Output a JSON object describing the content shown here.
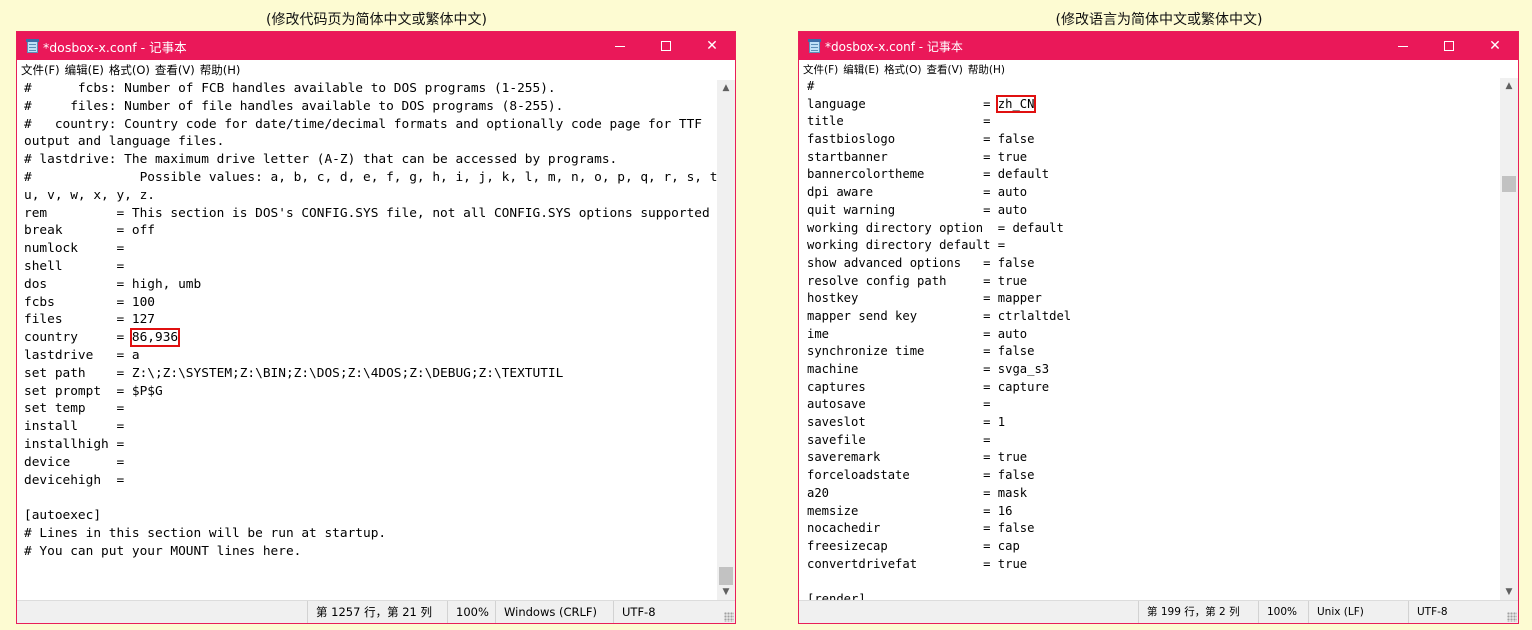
{
  "captions": {
    "left": "(修改代码页为简体中文或繁体中文)",
    "right": "(修改语言为简体中文或繁体中文)"
  },
  "app": {
    "title": "*dosbox-x.conf - 记事本",
    "menu": [
      "文件(F)",
      "编辑(E)",
      "格式(O)",
      "查看(V)",
      "帮助(H)"
    ]
  },
  "left_editor": {
    "lines_before": [
      "#      fcbs: Number of FCB handles available to DOS programs (1-255).",
      "#     files: Number of file handles available to DOS programs (8-255).",
      "#   country: Country code for date/time/decimal formats and optionally code page for TTF",
      "output and language files.",
      "# lastdrive: The maximum drive letter (A-Z) that can be accessed by programs.",
      "#              Possible values: a, b, c, d, e, f, g, h, i, j, k, l, m, n, o, p, q, r, s, t,",
      "u, v, w, x, y, z.",
      "rem         = This section is DOS's CONFIG.SYS file, not all CONFIG.SYS options supported",
      "break       = off",
      "numlock     =",
      "shell       =",
      "dos         = high, umb",
      "fcbs        = 100",
      "files       = 127"
    ],
    "highlight_prefix": "country     = ",
    "highlight_value": "86,936",
    "lines_after": [
      "lastdrive   = a",
      "set path    = Z:\\;Z:\\SYSTEM;Z:\\BIN;Z:\\DOS;Z:\\4DOS;Z:\\DEBUG;Z:\\TEXTUTIL",
      "set prompt  = $P$G",
      "set temp    =",
      "install     =",
      "installhigh =",
      "device      =",
      "devicehigh  =",
      "",
      "[autoexec]",
      "# Lines in this section will be run at startup.",
      "# You can put your MOUNT lines here."
    ]
  },
  "right_editor": {
    "lines_before": [
      "#"
    ],
    "highlight_prefix": "language                = ",
    "highlight_value": "zh_CN",
    "lines_after": [
      "title                   =",
      "fastbioslogo            = false",
      "startbanner             = true",
      "bannercolortheme        = default",
      "dpi aware               = auto",
      "quit warning            = auto",
      "working directory option  = default",
      "working directory default =",
      "show advanced options   = false",
      "resolve config path     = true",
      "hostkey                 = mapper",
      "mapper send key         = ctrlaltdel",
      "ime                     = auto",
      "synchronize time        = false",
      "machine                 = svga_s3",
      "captures                = capture",
      "autosave                =",
      "saveslot                = 1",
      "savefile                =",
      "saveremark              = true",
      "forceloadstate          = false",
      "a20                     = mask",
      "memsize                 = 16",
      "nocachedir              = false",
      "freesizecap             = cap",
      "convertdrivefat         = true",
      "",
      "[render]"
    ]
  },
  "left_status": {
    "position": "第 1257 行，第 21 列",
    "zoom": "100%",
    "line_ending": "Windows (CRLF)",
    "encoding": "UTF-8"
  },
  "right_status": {
    "position": "第 199 行，第 2 列",
    "zoom": "100%",
    "line_ending": "Unix (LF)",
    "encoding": "UTF-8"
  },
  "colors": {
    "titlebar": "#ea1859",
    "highlight_box": "#e01010",
    "page_background": "#fdfbd2"
  },
  "icons": {
    "app": "notepad-icon",
    "minimize": "minimize-icon",
    "maximize": "maximize-icon",
    "close": "close-icon",
    "scroll_up": "chevron-up-icon",
    "scroll_down": "chevron-down-icon",
    "grip": "resize-grip-icon"
  }
}
